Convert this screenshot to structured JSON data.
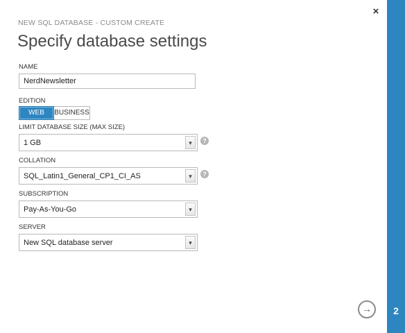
{
  "header": {
    "subheading": "NEW SQL DATABASE - CUSTOM CREATE",
    "title": "Specify database settings",
    "close_icon": "×"
  },
  "form": {
    "name": {
      "label": "NAME",
      "value": "NerdNewsletter"
    },
    "edition": {
      "label": "EDITION",
      "options": [
        "WEB",
        "BUSINESS"
      ],
      "selected": "WEB"
    },
    "size": {
      "label": "LIMIT DATABASE SIZE (MAX SIZE)",
      "value": "1 GB"
    },
    "collation": {
      "label": "COLLATION",
      "value": "SQL_Latin1_General_CP1_CI_AS"
    },
    "subscription": {
      "label": "SUBSCRIPTION",
      "value": "Pay-As-You-Go"
    },
    "server": {
      "label": "SERVER",
      "value": "New SQL database server"
    }
  },
  "icons": {
    "help": "?",
    "dropdown": "▾",
    "next": "→"
  },
  "footer": {
    "step": "2"
  },
  "colors": {
    "accent": "#2e86c1",
    "strip": "#2e86c1"
  }
}
